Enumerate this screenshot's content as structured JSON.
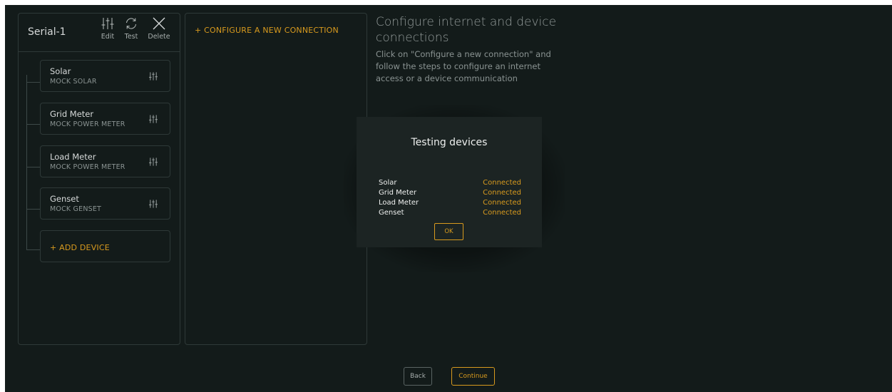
{
  "connection": {
    "title": "Serial-1",
    "actions": [
      {
        "label": "Edit",
        "icon": "sliders-icon"
      },
      {
        "label": "Test",
        "icon": "refresh-icon"
      },
      {
        "label": "Delete",
        "icon": "close-icon"
      }
    ],
    "devices": [
      {
        "name": "Solar",
        "type": "MOCK SOLAR"
      },
      {
        "name": "Grid Meter",
        "type": "MOCK POWER METER"
      },
      {
        "name": "Load Meter",
        "type": "MOCK POWER METER"
      },
      {
        "name": "Genset",
        "type": "MOCK GENSET"
      }
    ],
    "add_device_label": "+ ADD DEVICE"
  },
  "configure": {
    "new_connection_label": "+ CONFIGURE A NEW CONNECTION"
  },
  "info": {
    "title": "Configure internet and device connections",
    "text": "Click on \"Configure a new connection\" and follow the steps to configure an internet access or a device communication"
  },
  "modal": {
    "title": "Testing devices",
    "results": [
      {
        "name": "Solar",
        "status": "Connected"
      },
      {
        "name": "Grid Meter",
        "status": "Connected"
      },
      {
        "name": "Load Meter",
        "status": "Connected"
      },
      {
        "name": "Genset",
        "status": "Connected"
      }
    ],
    "ok_label": "OK"
  },
  "footer": {
    "back_label": "Back",
    "continue_label": "Continue"
  },
  "colors": {
    "background": "#131b1a",
    "accent": "#d89a1e",
    "border": "#2e3938"
  }
}
